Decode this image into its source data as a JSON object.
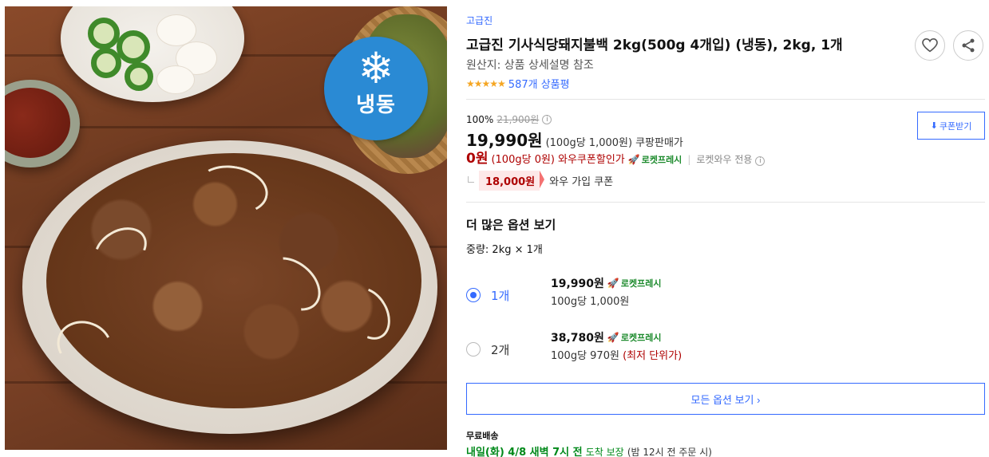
{
  "image": {
    "badge_icon": "snowflake-icon",
    "badge_text": "냉동"
  },
  "product": {
    "brand": "고급진",
    "title": "고급진 기사식당돼지불백 2kg(500g 4개입) (냉동), 2kg, 1개",
    "origin": "원산지: 상품 상세설명 참조",
    "rating_stars": 5,
    "review_count": "587개 상품평"
  },
  "actions": {
    "wishlist_icon": "heart-icon",
    "share_icon": "share-icon"
  },
  "pricing": {
    "discount_rate": "100%",
    "original_price": "21,900원",
    "price": "19,990원",
    "price_unit": "(100g당 1,000원)",
    "seller_label": "쿠팡판매가",
    "wow_price": "0원",
    "wow_unit": "(100g당 0원)",
    "wow_label": "와우쿠폰할인가",
    "rocket_fresh": "로켓프레시",
    "wow_only": "로켓와우 전용",
    "coupon_amount": "18,000원",
    "coupon_text": "와우 가입 쿠폰",
    "coupon_button": "쿠폰받기"
  },
  "options": {
    "title": "더 많은 옵션 보기",
    "weight_label": "중량: 2kg × 1개",
    "items": [
      {
        "qty": "1개",
        "price": "19,990원",
        "badge": "로켓프레시",
        "unit_price": "100g당 1,000원",
        "note": "",
        "selected": true
      },
      {
        "qty": "2개",
        "price": "38,780원",
        "badge": "로켓프레시",
        "unit_price": "100g당 970원",
        "note": "(최저 단위가)",
        "selected": false
      }
    ],
    "all_options_button": "모든 옵션 보기 ›"
  },
  "shipping": {
    "label": "무료배송",
    "date": "내일(화) 4/8 새벽 7시 전",
    "guarantee": "도착 보장",
    "cutoff": "(밤 12시 전 주문 시)"
  },
  "colors": {
    "accent_blue": "#346aff",
    "wow_red": "#ae0000",
    "rocket_green": "#1d8b2d",
    "star_orange": "#f5a623",
    "frozen_badge": "#2a8ad4"
  }
}
